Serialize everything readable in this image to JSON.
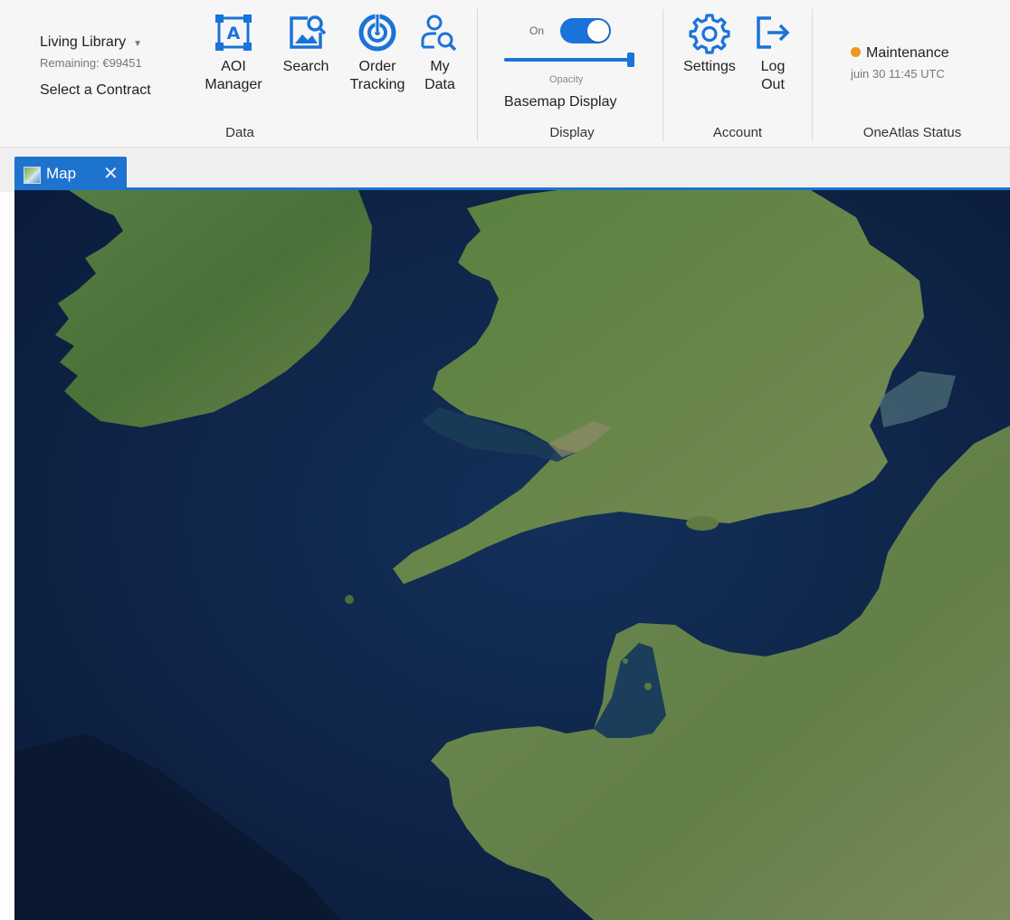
{
  "ribbon": {
    "contract": {
      "name": "Living Library",
      "remaining": "Remaining: €99451",
      "select_label": "Select a Contract"
    },
    "groups": {
      "data": {
        "label": "Data",
        "tools": {
          "aoi": {
            "line1": "AOI",
            "line2": "Manager",
            "icon": "aoi-manager-icon"
          },
          "search": {
            "line1": "Search",
            "line2": "",
            "icon": "image-search-icon"
          },
          "order": {
            "line1": "Order",
            "line2": "Tracking",
            "icon": "order-tracking-icon"
          },
          "mydata": {
            "line1": "My",
            "line2": "Data",
            "icon": "user-search-icon"
          }
        }
      },
      "display": {
        "label": "Display",
        "toggle_on_label": "On",
        "toggle_state": true,
        "opacity_label": "Opacity",
        "opacity_value": 1.0,
        "basemap_label": "Basemap Display"
      },
      "account": {
        "label": "Account",
        "tools": {
          "settings": {
            "line1": "Settings",
            "line2": "",
            "icon": "gear-icon"
          },
          "logout": {
            "line1": "Log",
            "line2": "Out",
            "icon": "logout-icon"
          }
        }
      },
      "status": {
        "label": "OneAtlas Status",
        "state": "Maintenance",
        "state_color": "#f0961c",
        "time": "juin 30 11:45 UTC"
      }
    }
  },
  "tabs": [
    {
      "label": "Map",
      "icon": "map-thumbnail-icon",
      "close": "✕"
    }
  ],
  "colors": {
    "accent": "#1e73cf",
    "sea": "#0f2142",
    "land": "#4f7a3d"
  }
}
